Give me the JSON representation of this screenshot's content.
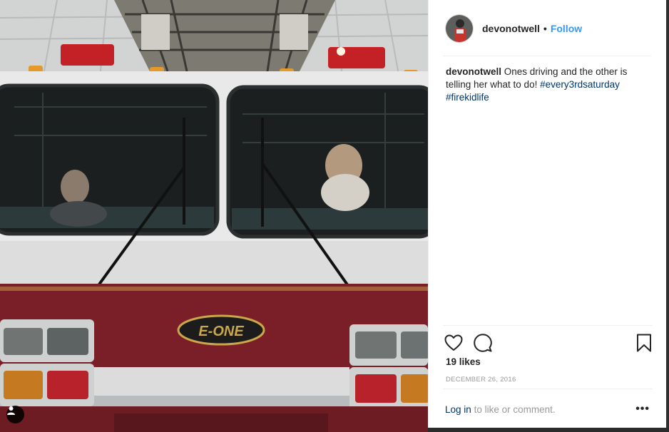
{
  "post": {
    "username": "devonotwell",
    "separator": "•",
    "follow_label": "Follow",
    "caption_text": "Ones driving and the other is telling her what to do!",
    "hashtags": [
      "#every3rdsaturday",
      "#firekidlife"
    ],
    "likes": "19 likes",
    "date": "DECEMBER 26, 2016",
    "login_link": "Log in",
    "login_suffix": "to like or comment.",
    "more_label": "•••"
  },
  "photo": {
    "brand_plate": "E-ONE"
  },
  "icons": {
    "like": "heart-icon",
    "comment": "comment-icon",
    "save": "bookmark-icon",
    "user_tag": "person-icon"
  },
  "colors": {
    "link_blue": "#3897f0",
    "hashtag": "#003569",
    "truck_red": "#7a1f28"
  }
}
